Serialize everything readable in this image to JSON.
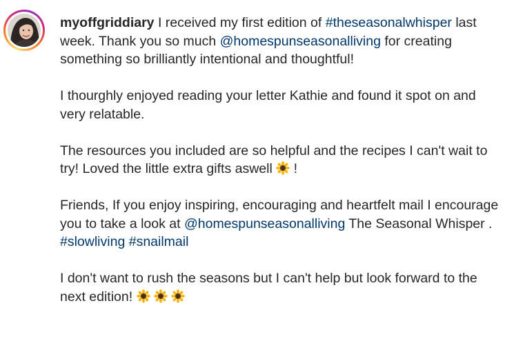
{
  "caption": {
    "username": "myoffgriddiary",
    "p1_text1": " I received my first edition of ",
    "p1_hashtag": "#theseasonalwhisper",
    "p1_text2": " last week. Thank you so much ",
    "p1_mention": "@homespunseasonalliving",
    "p1_text3": " for creating something so brilliantly intentional and thoughtful!",
    "p2_text": "I thourghly enjoyed reading your letter Kathie and found it spot on and very relatable.",
    "p3_text1": "The resources you included are so helpful and the recipes I can't wait to try! Loved the little extra gifts aswell ",
    "p3_text2": " !",
    "p4_text1": "Friends, If you enjoy inspiring, encouraging and heartfelt mail I encourage you to take a look at ",
    "p4_mention": "@homespunseasonalliving",
    "p4_text2": " The Seasonal Whisper . ",
    "p4_hashtag1": "#slowliving",
    "p4_hashtag2": "#snailmail",
    "p5_text": "I don't want to rush the seasons but I can't help but look forward to the next edition! "
  },
  "icons": {
    "avatar": "profile-photo",
    "emoji": "sunflower-emoji"
  },
  "colors": {
    "text": "#262626",
    "link": "#00376b",
    "story_ring": [
      "#feda75",
      "#fa7e1e",
      "#d62976",
      "#962fbf"
    ]
  }
}
